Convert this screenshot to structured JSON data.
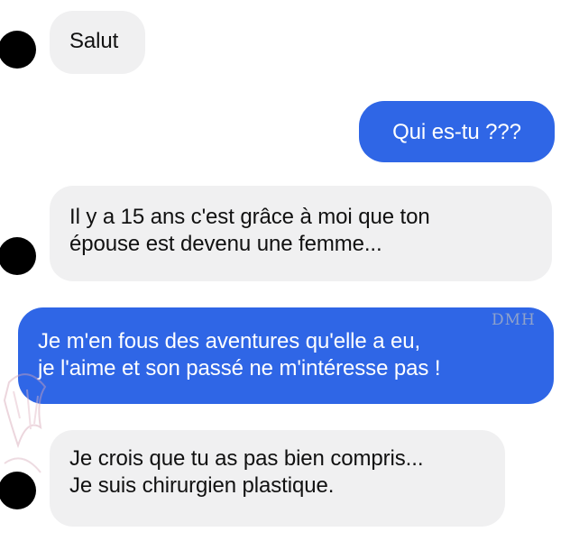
{
  "conversation": {
    "messages": [
      {
        "sender": "contact",
        "text": "Salut"
      },
      {
        "sender": "me",
        "text": "Qui es-tu ???"
      },
      {
        "sender": "contact",
        "text": "Il y a 15 ans c'est grâce à moi que ton\népouse est devenu une femme..."
      },
      {
        "sender": "me",
        "text": "Je m'en fous des aventures qu'elle a eu,\nje l'aime et son passé ne m'intéresse pas !"
      },
      {
        "sender": "contact",
        "text": "Je crois que tu as pas bien compris...\nJe suis chirurgien plastique."
      }
    ],
    "watermark": "DMH"
  },
  "colors": {
    "outgoing_bubble": "#2f66e6",
    "incoming_bubble": "#f0f0f1",
    "avatar": "#000000"
  }
}
